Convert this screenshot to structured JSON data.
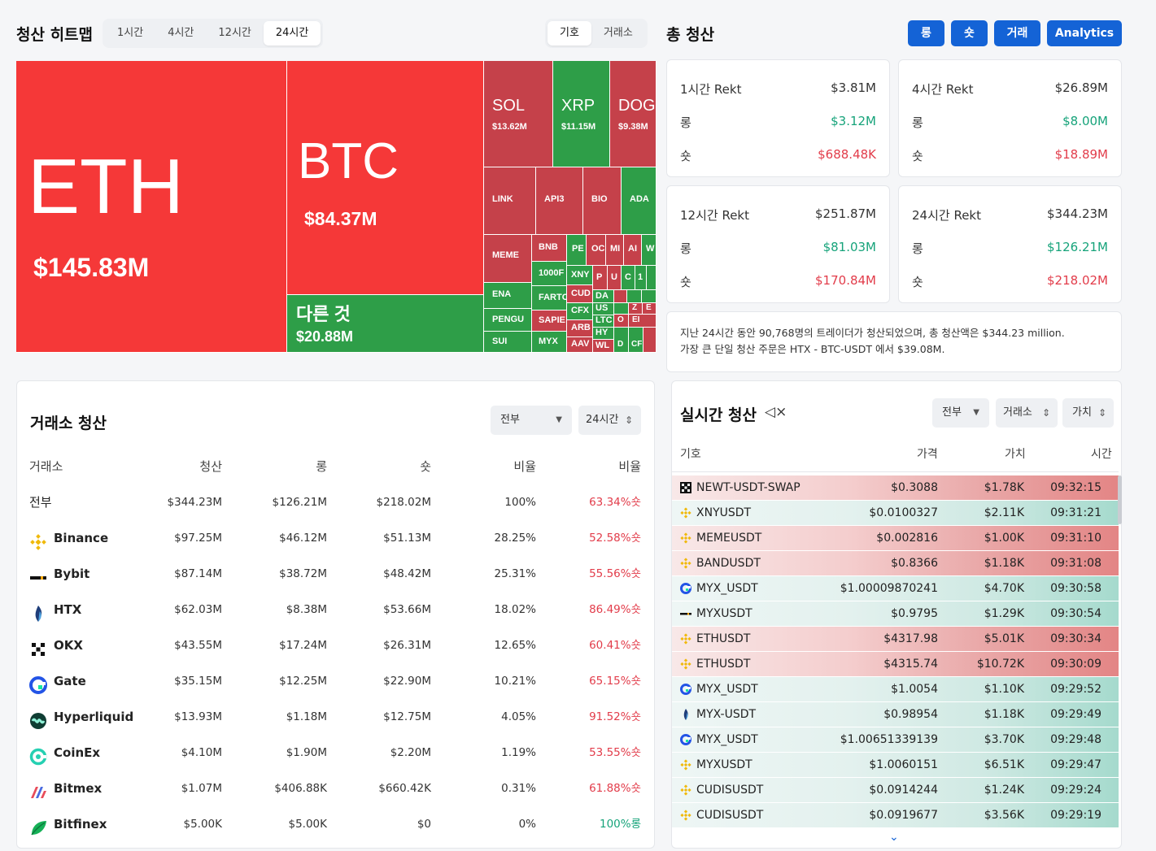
{
  "heatmap": {
    "title": "청산 히트맵",
    "tabs": [
      "1시간",
      "4시간",
      "12시간",
      "24시간"
    ],
    "active_tab": "24시간",
    "mode_tabs": [
      "기호",
      "거래소"
    ],
    "active_mode": "기호",
    "tiles": {
      "eth": {
        "sym": "ETH",
        "val": "$145.83M"
      },
      "btc": {
        "sym": "BTC",
        "val": "$84.37M"
      },
      "other": {
        "sym": "다른 것",
        "val": "$20.88M"
      },
      "sol": {
        "sym": "SOL",
        "val": "$13.62M"
      },
      "xrp": {
        "sym": "XRP",
        "val": "$11.15M"
      },
      "doge": {
        "sym": "DOG",
        "val": "$9.38M"
      },
      "small": [
        "LINK",
        "API3",
        "BIO",
        "ADA",
        "MEME",
        "BNB",
        "ENA",
        "1000F",
        "FARTC",
        "PENGU",
        "SAPIE",
        "SUI",
        "MYX",
        "XNY",
        "CUD",
        "CFX",
        "ARB",
        "AAV",
        "PE",
        "OC",
        "MI",
        "AI",
        "W",
        "P",
        "U",
        "C",
        "1",
        "DA",
        "US",
        "LTC",
        "HY",
        "WL",
        "O",
        "EI",
        "CF",
        "Z",
        "E",
        "D"
      ]
    }
  },
  "totals": {
    "title": "총 청산",
    "buttons": [
      "롱",
      "숏",
      "거래",
      "Analytics"
    ],
    "cards": [
      {
        "label": "1시간 Rekt",
        "total": "$3.81M",
        "long_label": "롱",
        "long": "$3.12M",
        "short_label": "숏",
        "short": "$688.48K"
      },
      {
        "label": "4시간 Rekt",
        "total": "$26.89M",
        "long_label": "롱",
        "long": "$8.00M",
        "short_label": "숏",
        "short": "$18.89M"
      },
      {
        "label": "12시간 Rekt",
        "total": "$251.87M",
        "long_label": "롱",
        "long": "$81.03M",
        "short_label": "숏",
        "short": "$170.84M"
      },
      {
        "label": "24시간 Rekt",
        "total": "$344.23M",
        "long_label": "롱",
        "long": "$126.21M",
        "short_label": "숏",
        "short": "$218.02M"
      }
    ],
    "summary_line1": "지난 24시간 동안 90,768명의 트레이더가 청산되었으며, 총 청산액은 $344.23 million.",
    "summary_line2": "가장 큰 단일 청산 주문은 HTX - BTC-USDT 에서 $39.08M."
  },
  "exchange": {
    "title": "거래소 청산",
    "filter": "전부",
    "period": "24시간",
    "headers": [
      "거래소",
      "청산",
      "롱",
      "숏",
      "비율",
      "비율"
    ],
    "rows": [
      {
        "name": "전부",
        "total": "$344.23M",
        "long": "$126.21M",
        "short": "$218.02M",
        "ratio": "100%",
        "bias": "63.34%숏",
        "bias_color": "#e23c4a",
        "logo": ""
      },
      {
        "name": "Binance",
        "total": "$97.25M",
        "long": "$46.12M",
        "short": "$51.13M",
        "ratio": "28.25%",
        "bias": "52.58%숏",
        "bias_color": "#e23c4a",
        "logo": "binance"
      },
      {
        "name": "Bybit",
        "total": "$87.14M",
        "long": "$38.72M",
        "short": "$48.42M",
        "ratio": "25.31%",
        "bias": "55.56%숏",
        "bias_color": "#e23c4a",
        "logo": "bybit"
      },
      {
        "name": "HTX",
        "total": "$62.03M",
        "long": "$8.38M",
        "short": "$53.66M",
        "ratio": "18.02%",
        "bias": "86.49%숏",
        "bias_color": "#e23c4a",
        "logo": "htx"
      },
      {
        "name": "OKX",
        "total": "$43.55M",
        "long": "$17.24M",
        "short": "$26.31M",
        "ratio": "12.65%",
        "bias": "60.41%숏",
        "bias_color": "#e23c4a",
        "logo": "okx"
      },
      {
        "name": "Gate",
        "total": "$35.15M",
        "long": "$12.25M",
        "short": "$22.90M",
        "ratio": "10.21%",
        "bias": "65.15%숏",
        "bias_color": "#e23c4a",
        "logo": "gate"
      },
      {
        "name": "Hyperliquid",
        "total": "$13.93M",
        "long": "$1.18M",
        "short": "$12.75M",
        "ratio": "4.05%",
        "bias": "91.52%숏",
        "bias_color": "#e23c4a",
        "logo": "hyperliquid"
      },
      {
        "name": "CoinEx",
        "total": "$4.10M",
        "long": "$1.90M",
        "short": "$2.20M",
        "ratio": "1.19%",
        "bias": "53.55%숏",
        "bias_color": "#e23c4a",
        "logo": "coinex"
      },
      {
        "name": "Bitmex",
        "total": "$1.07M",
        "long": "$406.88K",
        "short": "$660.42K",
        "ratio": "0.31%",
        "bias": "61.88%숏",
        "bias_color": "#e23c4a",
        "logo": "bitmex"
      },
      {
        "name": "Bitfinex",
        "total": "$5.00K",
        "long": "$5.00K",
        "short": "$0",
        "ratio": "0%",
        "bias": "100%롱",
        "bias_color": "#16a37a",
        "logo": "bitfinex"
      }
    ]
  },
  "live": {
    "title": "실시간 청산",
    "filters": [
      "전부",
      "거래소",
      "가치"
    ],
    "headers": [
      "기호",
      "가격",
      "가치",
      "시간"
    ],
    "rows": [
      {
        "symbol": "NEWT-USDT-SWAP",
        "price": "$0.3088",
        "value": "$1.78K",
        "time": "09:32:15",
        "side": "up",
        "logo": "okx"
      },
      {
        "symbol": "XNYUSDT",
        "price": "$0.0100327",
        "value": "$2.11K",
        "time": "09:31:21",
        "side": "dn",
        "logo": "binance"
      },
      {
        "symbol": "MEMEUSDT",
        "price": "$0.002816",
        "value": "$1.00K",
        "time": "09:31:10",
        "side": "up",
        "logo": "binance"
      },
      {
        "symbol": "BANDUSDT",
        "price": "$0.8366",
        "value": "$1.18K",
        "time": "09:31:08",
        "side": "up",
        "logo": "binance"
      },
      {
        "symbol": "MYX_USDT",
        "price": "$1.00009870241",
        "value": "$4.70K",
        "time": "09:30:58",
        "side": "dn",
        "logo": "gate"
      },
      {
        "symbol": "MYXUSDT",
        "price": "$0.9795",
        "value": "$1.29K",
        "time": "09:30:54",
        "side": "dn",
        "logo": "bybit"
      },
      {
        "symbol": "ETHUSDT",
        "price": "$4317.98",
        "value": "$5.01K",
        "time": "09:30:34",
        "side": "up",
        "logo": "binance"
      },
      {
        "symbol": "ETHUSDT",
        "price": "$4315.74",
        "value": "$10.72K",
        "time": "09:30:09",
        "side": "up",
        "logo": "binance"
      },
      {
        "symbol": "MYX_USDT",
        "price": "$1.0054",
        "value": "$1.10K",
        "time": "09:29:52",
        "side": "dn",
        "logo": "gate"
      },
      {
        "symbol": "MYX-USDT",
        "price": "$0.98954",
        "value": "$1.18K",
        "time": "09:29:49",
        "side": "dn",
        "logo": "htx"
      },
      {
        "symbol": "MYX_USDT",
        "price": "$1.00651339139",
        "value": "$3.70K",
        "time": "09:29:48",
        "side": "dn",
        "logo": "gate"
      },
      {
        "symbol": "MYXUSDT",
        "price": "$1.0060151",
        "value": "$6.51K",
        "time": "09:29:47",
        "side": "dn",
        "logo": "binance"
      },
      {
        "symbol": "CUDISUSDT",
        "price": "$0.0914244",
        "value": "$1.24K",
        "time": "09:29:24",
        "side": "dn",
        "logo": "binance"
      },
      {
        "symbol": "CUDISUSDT",
        "price": "$0.0919677",
        "value": "$3.56K",
        "time": "09:29:19",
        "side": "dn",
        "logo": "binance"
      }
    ]
  },
  "colors": {
    "accent": "#1463d6",
    "long": "#16a37a",
    "short": "#e23c4a",
    "tile_red": "#f53838",
    "tile_dark_red": "#c5414a",
    "tile_green": "#2e9e48"
  }
}
